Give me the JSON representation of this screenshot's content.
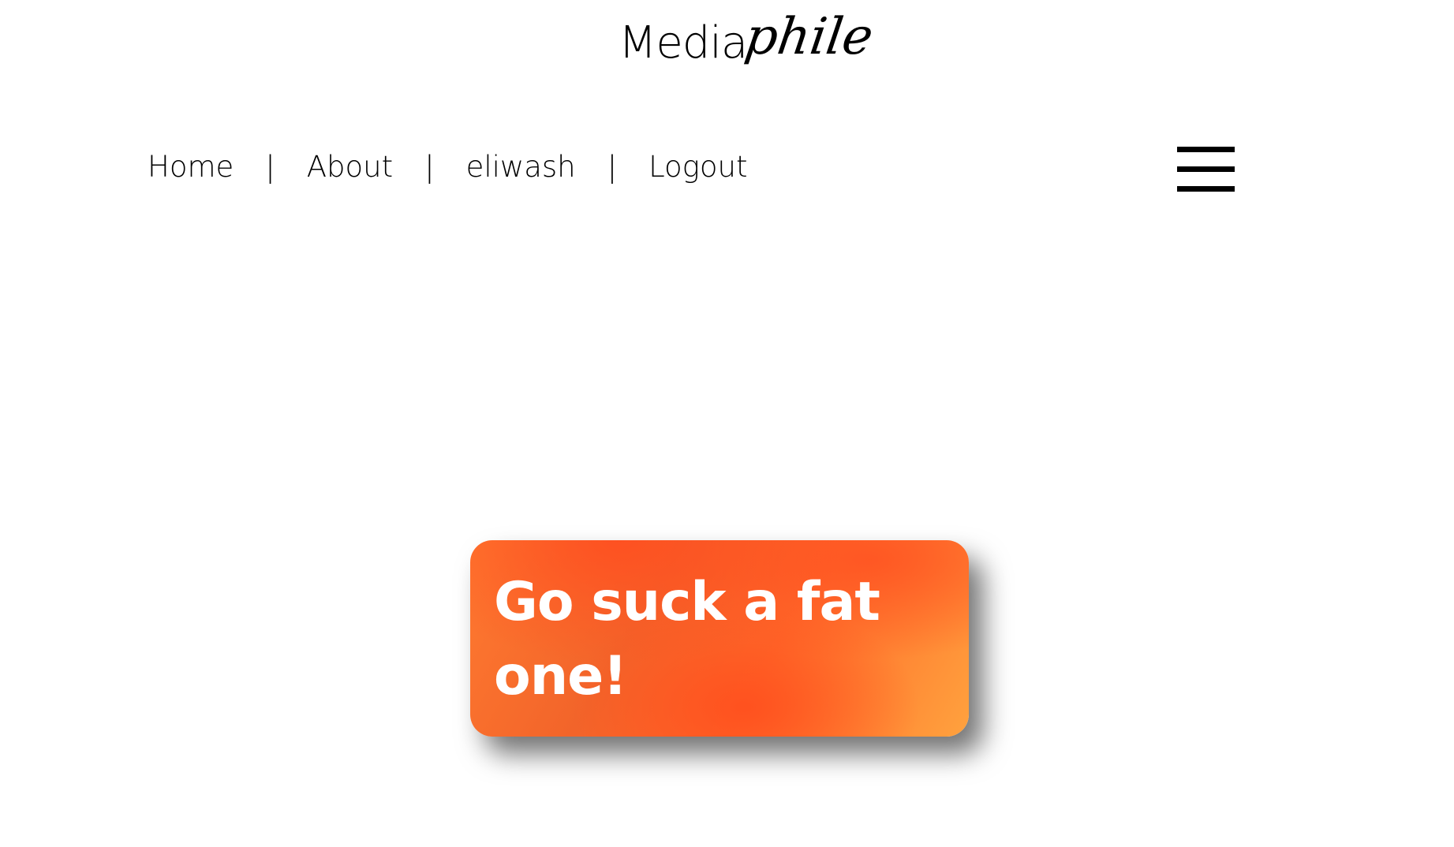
{
  "logo": {
    "plain": "Media",
    "script": "phile"
  },
  "nav": {
    "items": [
      {
        "label": "Home"
      },
      {
        "label": "About"
      },
      {
        "label": "eliwash"
      },
      {
        "label": "Logout"
      }
    ],
    "separator": "|"
  },
  "menu": {
    "icon": "hamburger-menu-icon"
  },
  "card": {
    "message": "Go suck a fat one!",
    "colors": {
      "primary": "#ff5722",
      "accent": "#ffa23e",
      "text": "#ffffff"
    }
  }
}
